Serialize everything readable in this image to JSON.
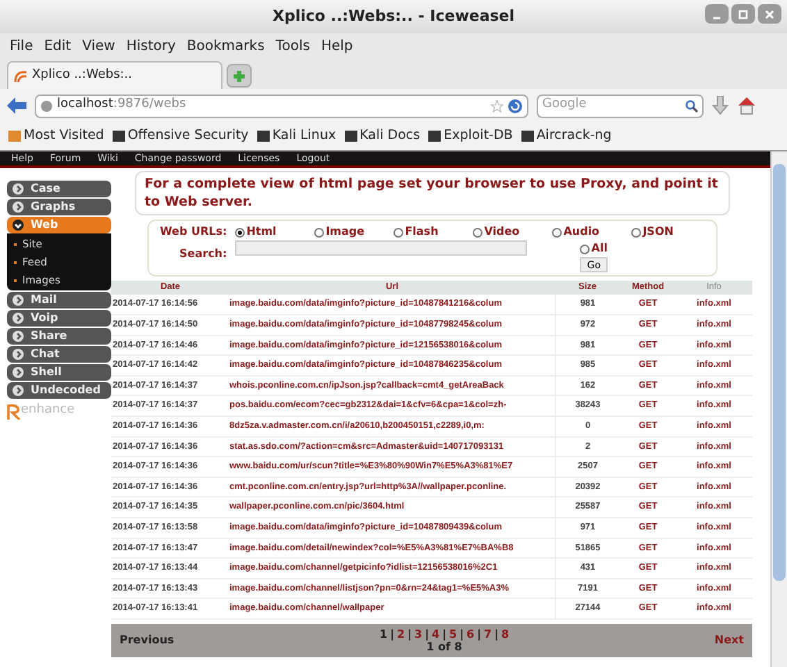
{
  "window": {
    "title": "Xplico ..:Webs:.. - Iceweasel"
  },
  "menu": [
    "File",
    "Edit",
    "View",
    "History",
    "Bookmarks",
    "Tools",
    "Help"
  ],
  "tab": {
    "title": "Xplico ..:Webs:.."
  },
  "address": {
    "host": "localhost",
    "path": ":9876/webs"
  },
  "search": {
    "placeholder": "Google"
  },
  "bookmarks": [
    "Most Visited",
    "Offensive Security",
    "Kali Linux",
    "Kali Docs",
    "Exploit-DB",
    "Aircrack-ng"
  ],
  "site_nav": [
    "Help",
    "Forum",
    "Wiki",
    "Change password",
    "Licenses",
    "Logout"
  ],
  "sidebar": [
    {
      "label": "Case",
      "expanded": false
    },
    {
      "label": "Graphs",
      "expanded": false
    },
    {
      "label": "Web",
      "expanded": true,
      "children": [
        "Site",
        "Feed",
        "Images"
      ]
    },
    {
      "label": "Mail",
      "expanded": false
    },
    {
      "label": "Voip",
      "expanded": false
    },
    {
      "label": "Share",
      "expanded": false
    },
    {
      "label": "Chat",
      "expanded": false
    },
    {
      "label": "Shell",
      "expanded": false
    },
    {
      "label": "Undecoded",
      "expanded": false
    }
  ],
  "logo": {
    "text": "enhance"
  },
  "notice": "For a complete view of html page set your browser to use Proxy, and point it to Web server.",
  "filter": {
    "label": "Web URLs:",
    "options": [
      {
        "label": "Html",
        "selected": true
      },
      {
        "label": "Image",
        "selected": false
      },
      {
        "label": "Flash",
        "selected": false
      },
      {
        "label": "Video",
        "selected": false
      },
      {
        "label": "Audio",
        "selected": false
      },
      {
        "label": "JSON",
        "selected": false
      },
      {
        "label": "All",
        "selected": false
      }
    ],
    "search_label": "Search:",
    "go": "Go"
  },
  "table": {
    "columns": [
      "Date",
      "Url",
      "Size",
      "Method",
      "Info"
    ],
    "rows": [
      [
        "2014-07-17 16:14:56",
        "image.baidu.com/data/imginfo?picture_id=10487841216&colum",
        "981",
        "GET",
        "info.xml"
      ],
      [
        "2014-07-17 16:14:50",
        "image.baidu.com/data/imginfo?picture_id=10487798245&colum",
        "972",
        "GET",
        "info.xml"
      ],
      [
        "2014-07-17 16:14:46",
        "image.baidu.com/data/imginfo?picture_id=12156538016&colum",
        "981",
        "GET",
        "info.xml"
      ],
      [
        "2014-07-17 16:14:42",
        "image.baidu.com/data/imginfo?picture_id=10487846235&colum",
        "985",
        "GET",
        "info.xml"
      ],
      [
        "2014-07-17 16:14:37",
        "whois.pconline.com.cn/ipJson.jsp?callback=cmt4_getAreaBack",
        "162",
        "GET",
        "info.xml"
      ],
      [
        "2014-07-17 16:14:37",
        "pos.baidu.com/ecom?cec=gb2312&dai=1&cfv=6&cpa=1&col=zh-",
        "38243",
        "GET",
        "info.xml"
      ],
      [
        "2014-07-17 16:14:36",
        "8dz5za.v.admaster.com.cn/i/a20610,b200450151,c2289,i0,m:",
        "0",
        "GET",
        "info.xml"
      ],
      [
        "2014-07-17 16:14:36",
        "stat.as.sdo.com/?action=cm&src=Admaster&uid=140717093131",
        "2",
        "GET",
        "info.xml"
      ],
      [
        "2014-07-17 16:14:36",
        "www.baidu.com/ur/scun?title=%E3%80%90Win7%E5%A3%81%E7",
        "2507",
        "GET",
        "info.xml"
      ],
      [
        "2014-07-17 16:14:36",
        "cmt.pconline.com.cn/entry.jsp?url=http%3A//wallpaper.pconline.",
        "20392",
        "GET",
        "info.xml"
      ],
      [
        "2014-07-17 16:14:35",
        "wallpaper.pconline.com.cn/pic/3604.html",
        "25587",
        "GET",
        "info.xml"
      ],
      [
        "2014-07-17 16:13:58",
        "image.baidu.com/data/imginfo?picture_id=10487809439&colum",
        "971",
        "GET",
        "info.xml"
      ],
      [
        "2014-07-17 16:13:47",
        "image.baidu.com/detail/newindex?col=%E5%A3%81%E7%BA%B8",
        "51865",
        "GET",
        "info.xml"
      ],
      [
        "2014-07-17 16:13:44",
        "image.baidu.com/channel/getpicinfo?idlist=12156538016%2C1",
        "431",
        "GET",
        "info.xml"
      ],
      [
        "2014-07-17 16:13:43",
        "image.baidu.com/channel/listjson?pn=0&rn=24&tag1=%E5%A3%",
        "7191",
        "GET",
        "info.xml"
      ],
      [
        "2014-07-17 16:13:41",
        "image.baidu.com/channel/wallpaper",
        "27144",
        "GET",
        "info.xml"
      ]
    ]
  },
  "pagination": {
    "previous": "Previous",
    "pages": [
      {
        "label": "1",
        "selected": true
      },
      {
        "label": "2",
        "selected": false
      },
      {
        "label": "3",
        "selected": false
      },
      {
        "label": "4",
        "selected": false
      },
      {
        "label": "5",
        "selected": false
      },
      {
        "label": "6",
        "selected": false
      },
      {
        "label": "7",
        "selected": false
      },
      {
        "label": "8",
        "selected": false
      }
    ],
    "separator": "|",
    "info": "1 of 8",
    "next": "Next"
  }
}
